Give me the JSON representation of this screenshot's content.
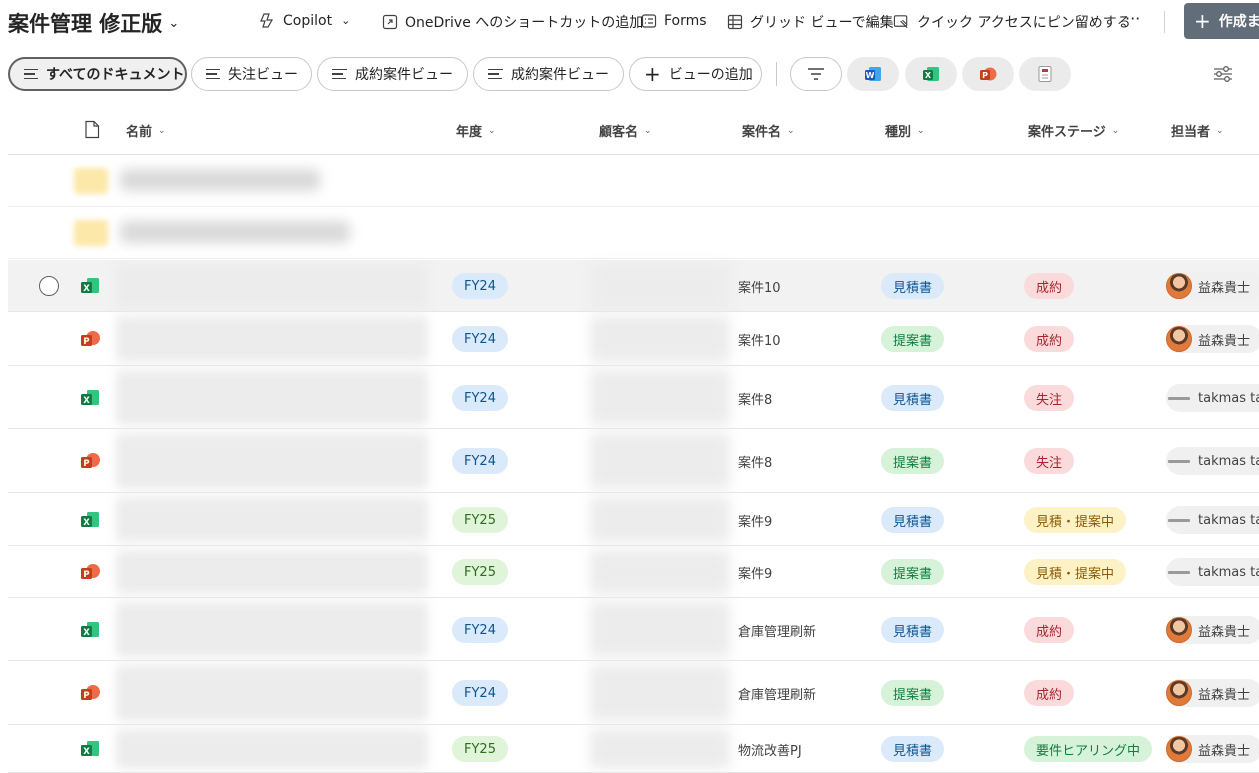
{
  "library": {
    "title": "案件管理 修正版"
  },
  "commands": {
    "copilot": "Copilot",
    "onedrive_shortcut": "OneDrive へのショートカットの追加",
    "forms": "Forms",
    "grid_edit": "グリッド ビューで編集",
    "pin_quick_access": "クイック アクセスにピン留めする",
    "more": "···",
    "create": "作成ま"
  },
  "views": [
    {
      "label": "すべてのドキュメント",
      "active": true
    },
    {
      "label": "失注ビュー",
      "active": false
    },
    {
      "label": "成約案件ビュー",
      "active": false
    },
    {
      "label": "成約案件ビュー",
      "active": false
    },
    {
      "label": "ビューの追加",
      "active": false
    }
  ],
  "app_filters": [
    {
      "icon": "word-icon",
      "color": "#185abd"
    },
    {
      "icon": "excel-icon",
      "color": "#107c41"
    },
    {
      "icon": "powerpoint-icon",
      "color": "#c43e1c"
    },
    {
      "icon": "forms-doc-icon",
      "color": "#c4314b"
    }
  ],
  "columns": {
    "name": "名前",
    "fiscal_year": "年度",
    "customer": "顧客名",
    "project": "案件名",
    "type": "種別",
    "stage": "案件ステージ",
    "owner": "担当者"
  },
  "colors": {
    "fy24_bg": "#dbeafb",
    "fy24_fg": "#0f548c",
    "fy25_bg": "#dff4d8",
    "fy25_fg": "#2c6e1e",
    "estimate_bg": "#dbeafb",
    "estimate_fg": "#0f548c",
    "proposal_bg": "#d6f2d9",
    "proposal_fg": "#107c41",
    "won_bg": "#fbdadc",
    "won_fg": "#a4262c",
    "inprogress_bg": "#fdf1c6",
    "inprogress_fg": "#8a5a00",
    "hearing_bg": "#d6f2d9",
    "hearing_fg": "#107c41",
    "excel": "#107c41",
    "powerpoint": "#c43e1c",
    "word": "#185abd"
  },
  "rows": [
    {
      "file_type": "excel",
      "fy": "FY24",
      "project": "案件10",
      "type": "見積書",
      "stage": "成約",
      "owner": "益森貴士",
      "owner_avatar": "photo",
      "selected": true
    },
    {
      "file_type": "powerpoint",
      "fy": "FY24",
      "project": "案件10",
      "type": "提案書",
      "stage": "成約",
      "owner": "益森貴士",
      "owner_avatar": "photo",
      "selected": false
    },
    {
      "file_type": "excel",
      "fy": "FY24",
      "project": "案件8",
      "type": "見積書",
      "stage": "失注",
      "owner": "takmas tan",
      "owner_avatar": "logo",
      "selected": false
    },
    {
      "file_type": "powerpoint",
      "fy": "FY24",
      "project": "案件8",
      "type": "提案書",
      "stage": "失注",
      "owner": "takmas tan",
      "owner_avatar": "logo",
      "selected": false
    },
    {
      "file_type": "excel",
      "fy": "FY25",
      "project": "案件9",
      "type": "見積書",
      "stage": "見積・提案中",
      "owner": "takmas tan",
      "owner_avatar": "logo",
      "selected": false
    },
    {
      "file_type": "powerpoint",
      "fy": "FY25",
      "project": "案件9",
      "type": "提案書",
      "stage": "見積・提案中",
      "owner": "takmas tan",
      "owner_avatar": "logo",
      "selected": false
    },
    {
      "file_type": "excel",
      "fy": "FY24",
      "project": "倉庫管理刷新",
      "type": "見積書",
      "stage": "成約",
      "owner": "益森貴士",
      "owner_avatar": "photo",
      "selected": false
    },
    {
      "file_type": "powerpoint",
      "fy": "FY24",
      "project": "倉庫管理刷新",
      "type": "提案書",
      "stage": "成約",
      "owner": "益森貴士",
      "owner_avatar": "photo",
      "selected": false
    },
    {
      "file_type": "excel",
      "fy": "FY25",
      "project": "物流改善PJ",
      "type": "見積書",
      "stage": "要件ヒアリング中",
      "owner": "益森貴士",
      "owner_avatar": "photo",
      "selected": false
    }
  ]
}
